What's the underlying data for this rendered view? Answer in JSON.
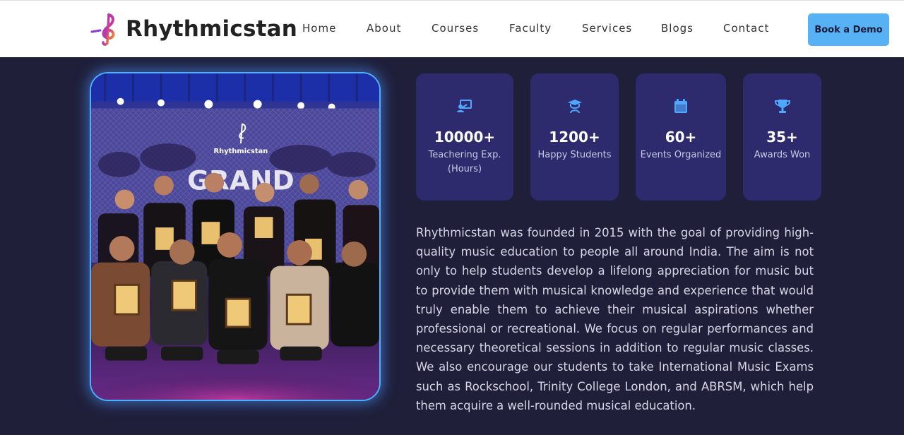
{
  "header": {
    "brand": "Rhythmicstan",
    "nav": [
      "Home",
      "About",
      "Courses",
      "Faculty",
      "Services",
      "Blogs",
      "Contact"
    ],
    "cta_label": "Book a Demo"
  },
  "photo": {
    "banner_brand": "Rhythmicstan",
    "banner_title": "GRAND"
  },
  "stats": [
    {
      "value": "10000+",
      "label": "Teachering Exp.(Hours)",
      "icon": "teacher-board-icon"
    },
    {
      "value": "1200+",
      "label": "Happy Students",
      "icon": "graduate-icon"
    },
    {
      "value": "60+",
      "label": "Events Organized",
      "icon": "calendar-icon"
    },
    {
      "value": "35+",
      "label": "Awards Won",
      "icon": "trophy-icon"
    }
  ],
  "about_text": "Rhythmicstan was founded in 2015 with the goal of providing high-quality music education to people all around India. The aim is not only to help students develop a lifelong appreciation for music but to provide them with musical knowledge and experience that would truly enable them to achieve their musical aspirations whether professional or recreational. We focus on regular performances and necessary theoretical sessions in addition to regular music classes. We also encourage our students to take International Music Exams such as Rockschool, Trinity College London, and ABRSM, which help them acquire a well-rounded musical education.",
  "colors": {
    "page_bg": "#1f1f3a",
    "card_bg": "#2d2a6e",
    "accent": "#56b1f5",
    "icon": "#4fa8ff"
  }
}
